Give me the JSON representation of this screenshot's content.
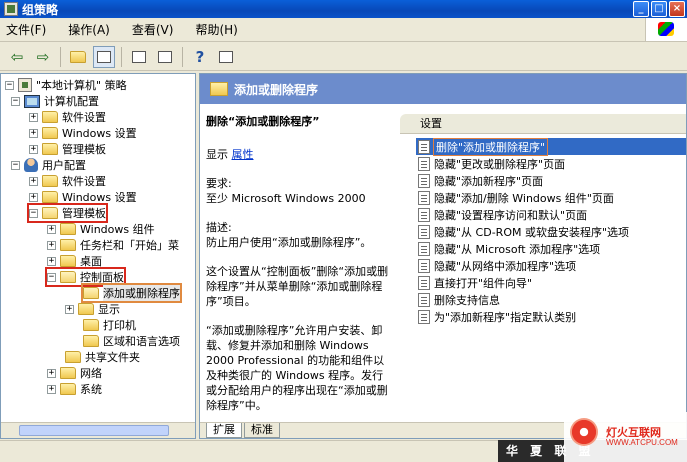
{
  "window": {
    "title": "组策略"
  },
  "menu": [
    "文件(F)",
    "操作(A)",
    "查看(V)",
    "帮助(H)"
  ],
  "tree": {
    "root": "\"本地计算机\" 策略",
    "computer_config": "计算机配置",
    "cc_software": "软件设置",
    "cc_windows": "Windows 设置",
    "cc_admin": "管理模板",
    "user_config": "用户配置",
    "uc_software": "软件设置",
    "uc_windows": "Windows 设置",
    "uc_admin": "管理模板",
    "windows_components": "Windows 组件",
    "taskbar": "任务栏和「开始」菜",
    "desktop": "桌面",
    "control_panel": "控制面板",
    "add_remove": "添加或删除程序",
    "display": "显示",
    "printers": "打印机",
    "regional": "区域和语言选项",
    "shared_folders": "共享文件夹",
    "network": "网络",
    "system": "系统"
  },
  "right": {
    "header": "添加或删除程序",
    "desc_title": "删除“添加或删除程序”",
    "display_label": "显示",
    "properties_link": "属性",
    "requirements_label": "要求:",
    "requirements_value": "至少 Microsoft Windows 2000",
    "description_label": "描述:",
    "description_text": "防止用户使用“添加或删除程序”。",
    "para2": "这个设置从“控制面板”删除“添加或删除程序”并从菜单删除“添加或删除程序”项目。",
    "para3": "“添加或删除程序”允许用户安装、卸载、修复并添加和删除 Windows 2000 Professional 的功能和组件以及种类很广的 Windows 程序。发行或分配给用户的程序出现在“添加或删除程序”中。",
    "list_header": "设置",
    "items": [
      "删除\"添加或删除程序\"",
      "隐藏\"更改或删除程序\"页面",
      "隐藏\"添加新程序\"页面",
      "隐藏\"添加/删除 Windows 组件\"页面",
      "隐藏\"设置程序访问和默认\"页面",
      "隐藏\"从 CD-ROM 或软盘安装程序\"选项",
      "隐藏\"从 Microsoft 添加程序\"选项",
      "隐藏\"从网络中添加程序\"选项",
      "直接打开\"组件向导\"",
      "删除支持信息",
      "为\"添加新程序\"指定默认类别"
    ],
    "tab_extended": "扩展",
    "tab_standard": "标准"
  },
  "watermark": {
    "bar_text": "华 夏 联 盟",
    "site_name": "灯火互联网",
    "site_url": "WWW.ATCPU.COM"
  }
}
